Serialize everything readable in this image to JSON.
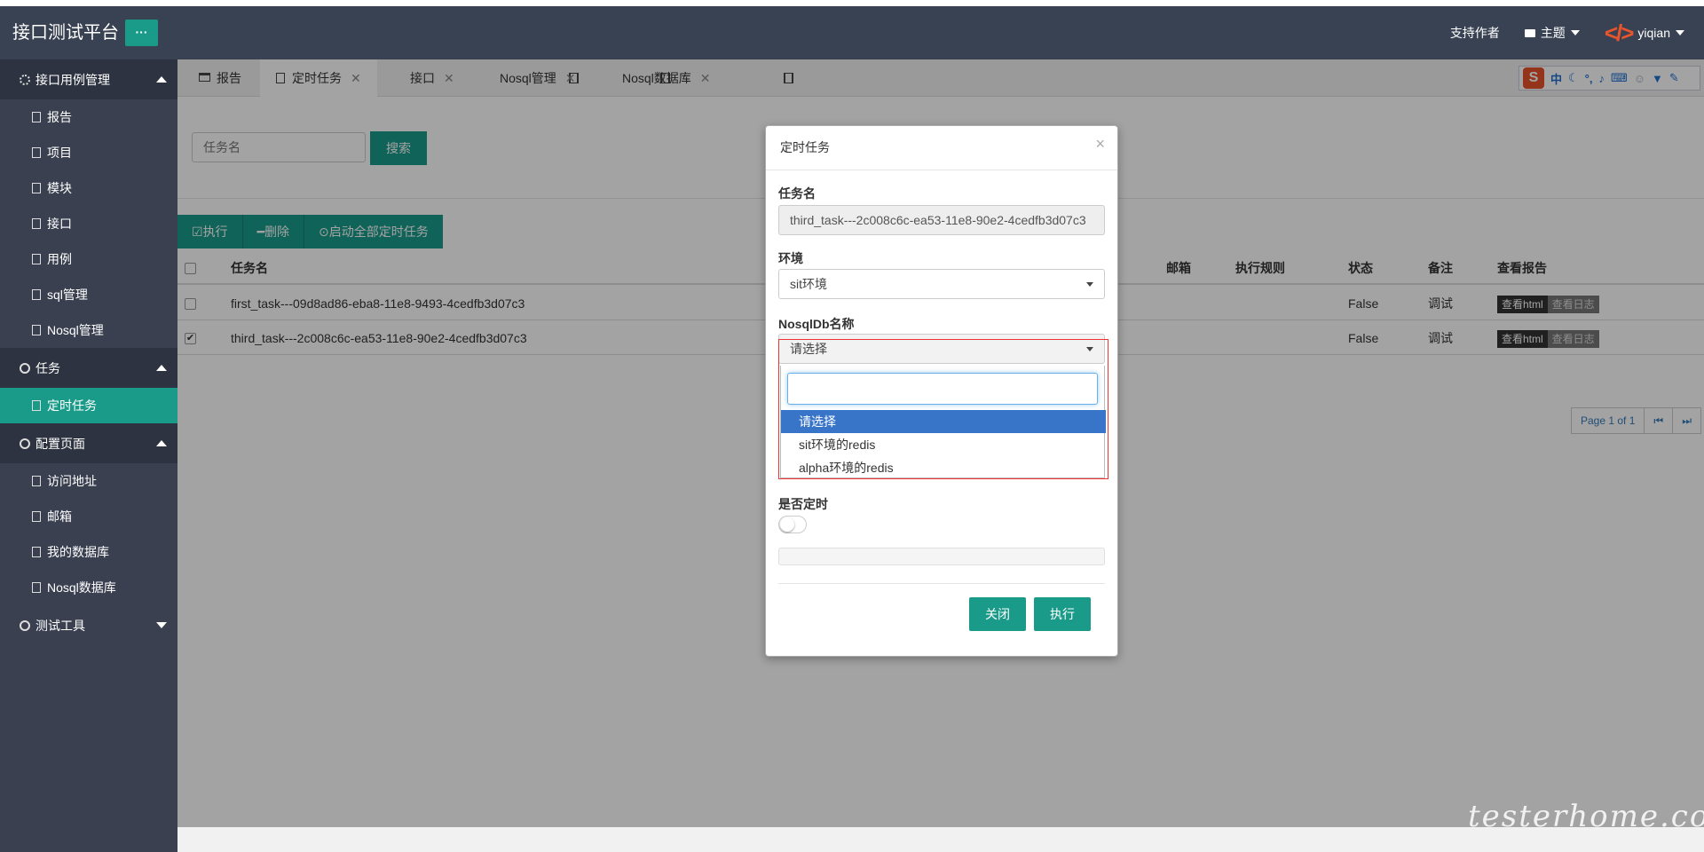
{
  "app": {
    "title": "接口测试平台",
    "menu_btn": "···"
  },
  "header": {
    "support": "支持作者",
    "theme": "主题",
    "user": "yiqian",
    "code_logo": "</>"
  },
  "sidebar": {
    "groups": [
      {
        "label": "接口用例管理",
        "items": [
          "报告",
          "项目",
          "模块",
          "接口",
          "用例",
          "sql管理",
          "Nosql管理"
        ]
      },
      {
        "label": "任务",
        "items": [
          "定时任务"
        ]
      },
      {
        "label": "配置页面",
        "items": [
          "访问地址",
          "邮箱",
          "我的数据库",
          "Nosql数据库"
        ]
      },
      {
        "label": "测试工具",
        "items": []
      }
    ]
  },
  "tabs": [
    {
      "label": "报告"
    },
    {
      "label": "定时任务"
    },
    {
      "label": "接口"
    },
    {
      "label": "Nosql管理"
    },
    {
      "label": "Nosql数据库"
    }
  ],
  "tab_close": "✕",
  "sogou": {
    "logo": "S",
    "mode": "中"
  },
  "search": {
    "placeholder": "任务名",
    "button": "搜索"
  },
  "toolbar": {
    "execute": "执行",
    "delete": "删除",
    "start_all": "启动全部定时任务"
  },
  "table": {
    "headers": {
      "name": "任务名",
      "email": "邮箱",
      "rule": "执行规则",
      "status": "状态",
      "note": "备注",
      "report": "查看报告"
    },
    "rows": [
      {
        "checked": false,
        "name": "first_task---09d8ad86-eba8-11e8-9493-4cedfb3d07c3",
        "status": "False",
        "note": "调试"
      },
      {
        "checked": true,
        "name": "third_task---2c008c6c-ea53-11e8-90e2-4cedfb3d07c3",
        "status": "False",
        "note": "调试"
      }
    ],
    "view_html": "查看html",
    "view_log": "查看日志"
  },
  "pager": {
    "text": "Page 1 of 1",
    "first": "⏮",
    "last": "⏭"
  },
  "modal": {
    "title": "定时任务",
    "close": "×",
    "name_label": "任务名",
    "name_value": "third_task---2c008c6c-ea53-11e8-90e2-4cedfb3d07c3",
    "env_label": "环境",
    "env_value": "sit环境",
    "nosql_label": "NosqlDb名称",
    "nosql_value": "请选择",
    "options": [
      "请选择",
      "sit环境的redis",
      "alpha环境的redis"
    ],
    "timer_label": "是否定时",
    "timer_on": false,
    "btn_close": "关闭",
    "btn_execute": "执行"
  },
  "watermark": "testerhome.com",
  "colors": {
    "header": "#394252",
    "accent": "#1a9b8a",
    "sidebar": "#3a4050",
    "selected_option": "#3875c9",
    "highlight_box": "#e33333"
  }
}
